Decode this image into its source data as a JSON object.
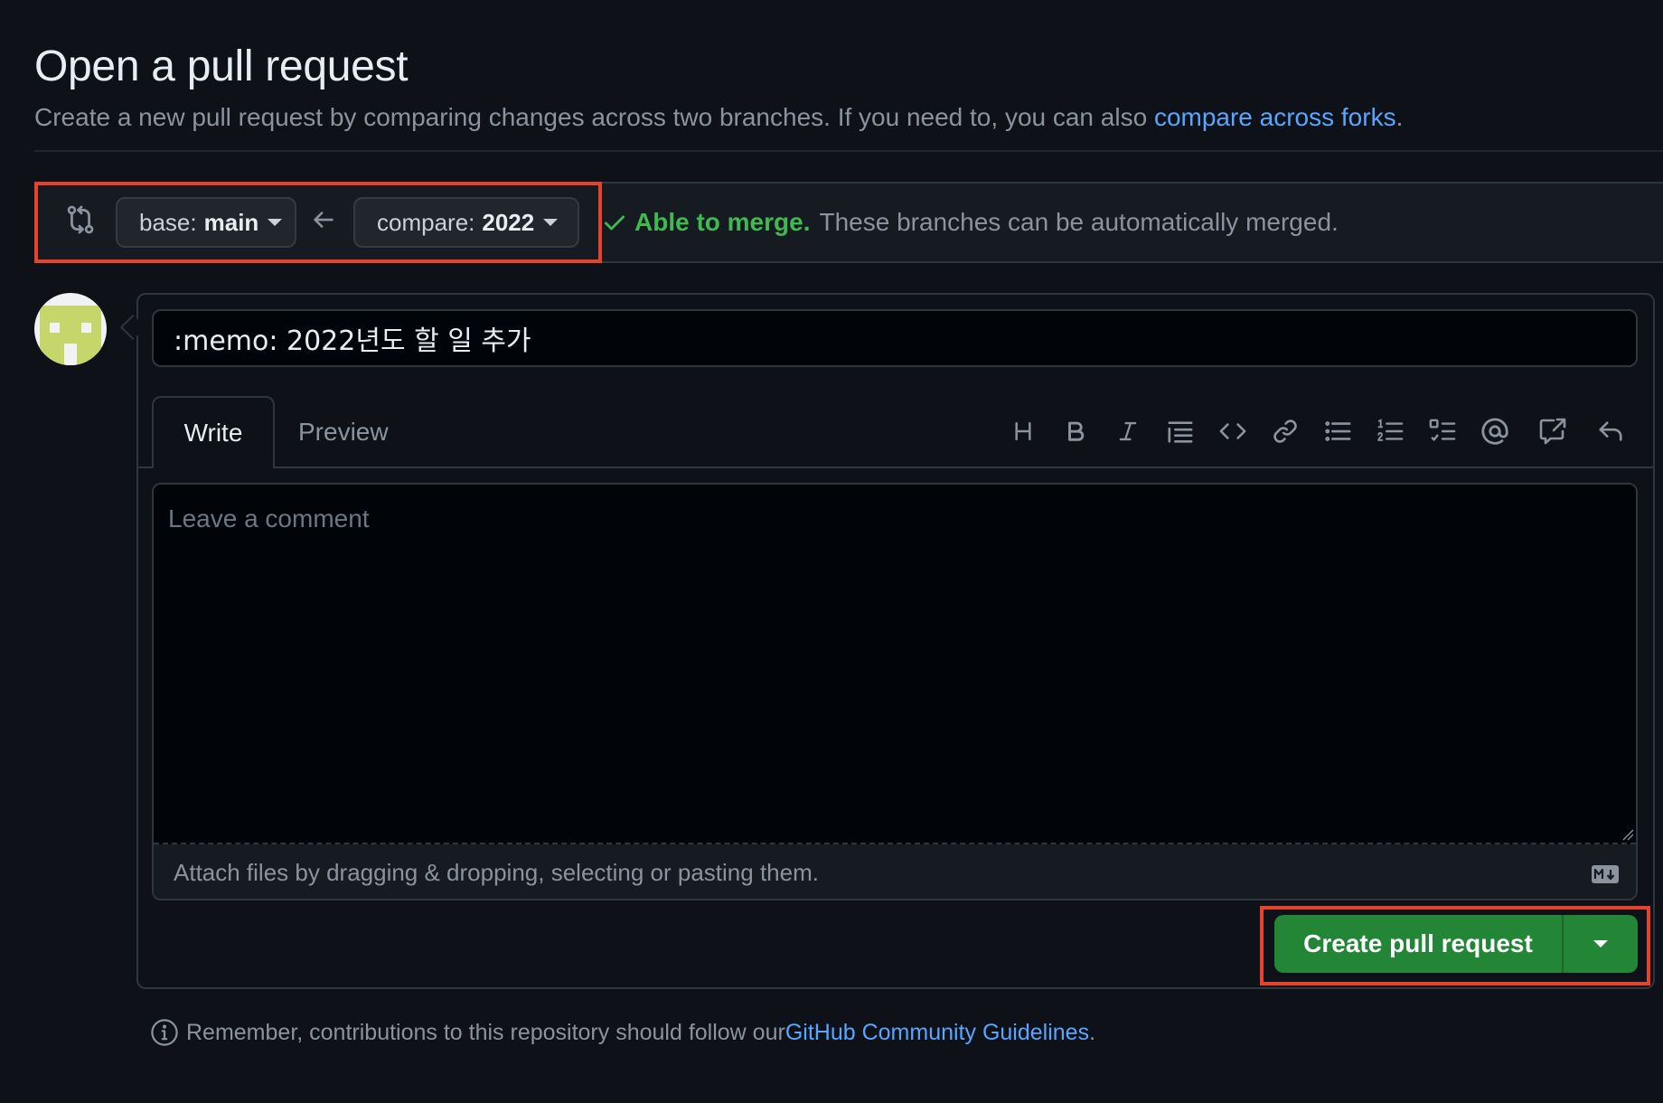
{
  "header": {
    "title": "Open a pull request",
    "subtitle_prefix": "Create a new pull request by comparing changes across two branches. If you need to, you can also ",
    "subtitle_link": "compare across forks",
    "subtitle_suffix": "."
  },
  "range": {
    "base_label": "base:",
    "base_value": "main",
    "compare_label": "compare:",
    "compare_value": "2022",
    "merge_ok": "Able to merge.",
    "merge_msg": "These branches can be automatically merged."
  },
  "form": {
    "title_value": ":memo: 2022년도 할 일 추가",
    "tabs": [
      {
        "label": "Write",
        "active": true
      },
      {
        "label": "Preview",
        "active": false
      }
    ],
    "toolbar_icons": [
      "heading-icon",
      "bold-icon",
      "italic-icon",
      "quote-icon",
      "code-icon",
      "link-icon",
      "unordered-list-icon",
      "ordered-list-icon",
      "task-list-icon",
      "mention-icon",
      "cross-reference-icon",
      "saved-replies-icon"
    ],
    "comment_placeholder": "Leave a comment",
    "attach_text": "Attach files by dragging & dropping, selecting or pasting them.",
    "markdown_icon": "markdown-icon",
    "submit_label": "Create pull request"
  },
  "footer": {
    "prefix": "Remember, contributions to this repository should follow our ",
    "link": "GitHub Community Guidelines",
    "suffix": "."
  },
  "colors": {
    "background": "#0e1117",
    "accent_link": "#58a6ff",
    "success": "#3fb950",
    "primary_button": "#238636",
    "highlight": "#e5432b"
  }
}
